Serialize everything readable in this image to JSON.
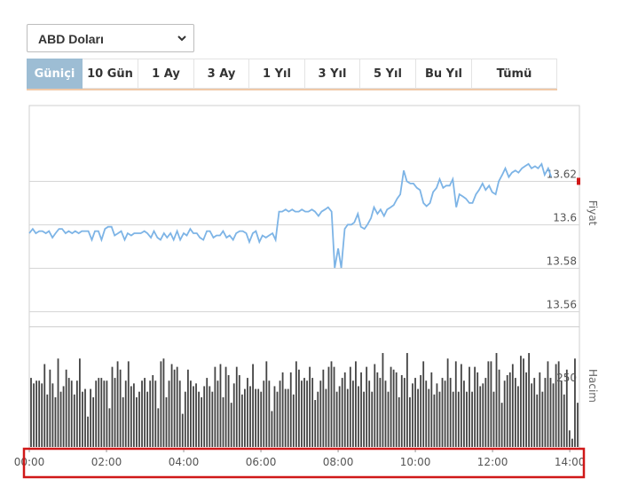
{
  "currency_select": {
    "value": "ABD Doları"
  },
  "tabs": [
    {
      "label": "Güniçi",
      "active": true
    },
    {
      "label": "10 Gün",
      "active": false
    },
    {
      "label": "1 Ay",
      "active": false
    },
    {
      "label": "3 Ay",
      "active": false
    },
    {
      "label": "1 Yıl",
      "active": false
    },
    {
      "label": "3 Yıl",
      "active": false
    },
    {
      "label": "5 Yıl",
      "active": false
    },
    {
      "label": "Bu Yıl",
      "active": false
    },
    {
      "label": "Tümü",
      "active": false
    }
  ],
  "colors": {
    "line": "#7db4e6",
    "bar": "#444444",
    "active_tab": "#9dbdd4",
    "highlight_box": "#d01818",
    "last_marker": "#d01818"
  },
  "chart_data": [
    {
      "type": "line",
      "ylabel": "Fiyat",
      "ylim": [
        13.553,
        13.655
      ],
      "yticks": [
        "13.62",
        "13.6",
        "13.58",
        "13.56"
      ],
      "ytick_values": [
        13.62,
        13.6,
        13.58,
        13.56
      ],
      "xlim": [
        0,
        14.25
      ],
      "xticks": [
        "00:00",
        "02:00",
        "04:00",
        "06:00",
        "08:00",
        "10:00",
        "12:00",
        "14:00"
      ],
      "xtick_values": [
        0,
        2,
        4,
        6,
        8,
        10,
        12,
        14
      ],
      "grid": true,
      "x": [
        0,
        0.09,
        0.17,
        0.26,
        0.34,
        0.43,
        0.51,
        0.6,
        0.68,
        0.77,
        0.85,
        0.94,
        1.02,
        1.11,
        1.19,
        1.28,
        1.36,
        1.45,
        1.53,
        1.62,
        1.7,
        1.79,
        1.87,
        1.96,
        2.04,
        2.13,
        2.21,
        2.3,
        2.38,
        2.47,
        2.55,
        2.64,
        2.72,
        2.81,
        2.89,
        2.98,
        3.06,
        3.15,
        3.23,
        3.32,
        3.4,
        3.49,
        3.57,
        3.66,
        3.74,
        3.83,
        3.91,
        4.0,
        4.08,
        4.17,
        4.25,
        4.34,
        4.42,
        4.51,
        4.6,
        4.68,
        4.77,
        4.85,
        4.94,
        5.02,
        5.11,
        5.19,
        5.28,
        5.36,
        5.45,
        5.53,
        5.62,
        5.7,
        5.79,
        5.87,
        5.96,
        6.04,
        6.13,
        6.21,
        6.3,
        6.38,
        6.47,
        6.55,
        6.64,
        6.72,
        6.81,
        6.89,
        6.98,
        7.06,
        7.15,
        7.23,
        7.32,
        7.4,
        7.49,
        7.57,
        7.66,
        7.74,
        7.83,
        7.91,
        8.0,
        8.08,
        8.17,
        8.25,
        8.34,
        8.42,
        8.51,
        8.59,
        8.68,
        8.76,
        8.85,
        8.93,
        9.02,
        9.1,
        9.19,
        9.27,
        9.36,
        9.44,
        9.53,
        9.61,
        9.7,
        9.78,
        9.87,
        9.95,
        10.04,
        10.12,
        10.21,
        10.29,
        10.38,
        10.46,
        10.55,
        10.63,
        10.72,
        10.8,
        10.89,
        10.97,
        11.06,
        11.14,
        11.23,
        11.31,
        11.4,
        11.48,
        11.57,
        11.65,
        11.74,
        11.82,
        11.91,
        11.99,
        12.08,
        12.16,
        12.25,
        12.33,
        12.42,
        12.5,
        12.59,
        12.67,
        12.76,
        12.84,
        12.93,
        13.01,
        13.1,
        13.18,
        13.27,
        13.35,
        13.44,
        13.52,
        13.61,
        13.69,
        13.78,
        13.86,
        13.95,
        14.03,
        14.12,
        14.2
      ],
      "values": [
        13.596,
        13.598,
        13.596,
        13.597,
        13.597,
        13.596,
        13.597,
        13.594,
        13.596,
        13.598,
        13.598,
        13.596,
        13.597,
        13.596,
        13.597,
        13.596,
        13.597,
        13.597,
        13.597,
        13.593,
        13.597,
        13.597,
        13.593,
        13.598,
        13.599,
        13.599,
        13.595,
        13.596,
        13.597,
        13.593,
        13.596,
        13.595,
        13.596,
        13.596,
        13.596,
        13.597,
        13.596,
        13.594,
        13.597,
        13.594,
        13.593,
        13.596,
        13.594,
        13.596,
        13.593,
        13.597,
        13.593,
        13.596,
        13.595,
        13.598,
        13.596,
        13.596,
        13.594,
        13.593,
        13.597,
        13.597,
        13.594,
        13.595,
        13.595,
        13.597,
        13.594,
        13.595,
        13.593,
        13.596,
        13.597,
        13.597,
        13.596,
        13.592,
        13.596,
        13.597,
        13.592,
        13.595,
        13.594,
        13.595,
        13.596,
        13.593,
        13.606,
        13.606,
        13.607,
        13.606,
        13.607,
        13.606,
        13.606,
        13.607,
        13.606,
        13.606,
        13.607,
        13.606,
        13.604,
        13.606,
        13.607,
        13.608,
        13.606,
        13.58,
        13.589,
        13.58,
        13.598,
        13.6,
        13.6,
        13.601,
        13.605,
        13.599,
        13.598,
        13.6,
        13.603,
        13.608,
        13.605,
        13.607,
        13.604,
        13.607,
        13.608,
        13.609,
        13.612,
        13.614,
        13.625,
        13.62,
        13.619,
        13.619,
        13.617,
        13.616,
        13.61,
        13.6085,
        13.61,
        13.615,
        13.617,
        13.621,
        13.617,
        13.618,
        13.618,
        13.621,
        13.608,
        13.614,
        13.613,
        13.612,
        13.61,
        13.61,
        13.614,
        13.616,
        13.619,
        13.616,
        13.618,
        13.615,
        13.614,
        13.62,
        13.623,
        13.626,
        13.622,
        13.624,
        13.625,
        13.624,
        13.626,
        13.627,
        13.628,
        13.626,
        13.627,
        13.626,
        13.628,
        13.623,
        13.626,
        13.622
      ],
      "last_value_marker": 13.62
    },
    {
      "type": "bar",
      "ylabel": "Hacim",
      "yticks": [
        "250"
      ],
      "ytick_values": [
        250
      ],
      "ylim": [
        0,
        430
      ],
      "xlim": [
        0,
        14.25
      ],
      "values": [
        250,
        230,
        240,
        240,
        230,
        300,
        190,
        280,
        230,
        180,
        320,
        200,
        220,
        280,
        250,
        240,
        190,
        240,
        320,
        200,
        210,
        110,
        210,
        180,
        240,
        250,
        250,
        240,
        240,
        140,
        290,
        250,
        310,
        280,
        180,
        240,
        310,
        220,
        230,
        180,
        200,
        240,
        250,
        200,
        240,
        260,
        240,
        140,
        310,
        320,
        180,
        240,
        300,
        280,
        290,
        240,
        120,
        200,
        280,
        240,
        220,
        230,
        200,
        180,
        220,
        250,
        220,
        200,
        290,
        240,
        300,
        180,
        290,
        260,
        160,
        230,
        290,
        260,
        190,
        210,
        250,
        220,
        300,
        210,
        210,
        200,
        240,
        310,
        240,
        130,
        220,
        200,
        240,
        270,
        210,
        210,
        270,
        190,
        310,
        280,
        240,
        250,
        240,
        290,
        250,
        170,
        200,
        240,
        280,
        210,
        290,
        310,
        290,
        200,
        220,
        250,
        270,
        210,
        290,
        240,
        310,
        220,
        270,
        200,
        290,
        240,
        200,
        300,
        270,
        250,
        340,
        240,
        200,
        290,
        280,
        270,
        180,
        260,
        250,
        340,
        180,
        230,
        250,
        210,
        260,
        310,
        240,
        210,
        270,
        190,
        230,
        200,
        250,
        240,
        320,
        250,
        200,
        310,
        200,
        300,
        240,
        200,
        290,
        200,
        290,
        270,
        220,
        230,
        250,
        310,
        310,
        200,
        340,
        280,
        160,
        240,
        260,
        270,
        300,
        250,
        220,
        330,
        320,
        270,
        340,
        230,
        250,
        190,
        270,
        200,
        250,
        310,
        250,
        230,
        300,
        310,
        240,
        190,
        280,
        60,
        30,
        320,
        160
      ]
    }
  ]
}
